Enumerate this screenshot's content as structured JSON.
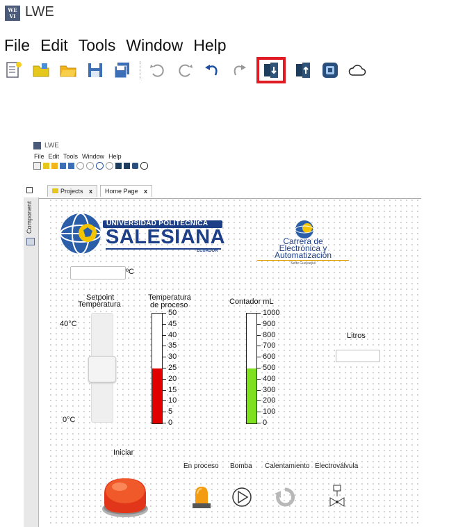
{
  "app": {
    "title": "LWE",
    "logo_text": "WE VI"
  },
  "menu": [
    "File",
    "Edit",
    "Tools",
    "Window",
    "Help"
  ],
  "toolbar_icons": [
    "new-file-icon",
    "open-folder-icon",
    "open-project-icon",
    "save-icon",
    "save-all-icon",
    "undo-icon",
    "redo-icon",
    "undo-alt-icon",
    "redo-alt-icon",
    "download-icon",
    "upload-icon",
    "device-icon",
    "cloud-icon"
  ],
  "inner": {
    "title": "LWE",
    "menu": [
      "File",
      "Edit",
      "Tools",
      "Window",
      "Help"
    ],
    "tabs": [
      {
        "label": "Projects",
        "close": "x"
      },
      {
        "label": "Home Page",
        "close": "x"
      }
    ],
    "side_label": "Component"
  },
  "page": {
    "university": {
      "line1": "UNIVERSIDAD POLITÉCNICA",
      "line2": "SALESIANA",
      "line3": "ECUADOR"
    },
    "career": {
      "line1": "Carrera de",
      "line2": "Electrónica y",
      "line3": "Automatización",
      "line4": "Sede Guayaquil"
    },
    "temp_unit": "ºC",
    "setpoint": {
      "title1": "Setpoint",
      "title2": "Temperatura",
      "max_label": "40°C",
      "min_label": "0°C",
      "value_fraction": 0.48
    },
    "temp_gauge": {
      "title1": "Temperatura",
      "title2": "de proceso",
      "ticks": [
        "50",
        "45",
        "40",
        "35",
        "30",
        "25",
        "20",
        "15",
        "10",
        "5",
        "0"
      ],
      "value": 25,
      "max": 50,
      "fill_color": "#e00000"
    },
    "counter": {
      "title": "Contador mL",
      "ticks": [
        "1000",
        "900",
        "800",
        "700",
        "600",
        "500",
        "400",
        "300",
        "200",
        "100",
        "0"
      ],
      "value": 500,
      "max": 1000,
      "fill_color": "#7fe020"
    },
    "litros": {
      "label": "Litros",
      "value": ""
    },
    "start_button": {
      "label": "Iniciar"
    },
    "indicators": [
      "En proceso",
      "Bomba",
      "Calentamiento",
      "Electroválvula"
    ]
  }
}
